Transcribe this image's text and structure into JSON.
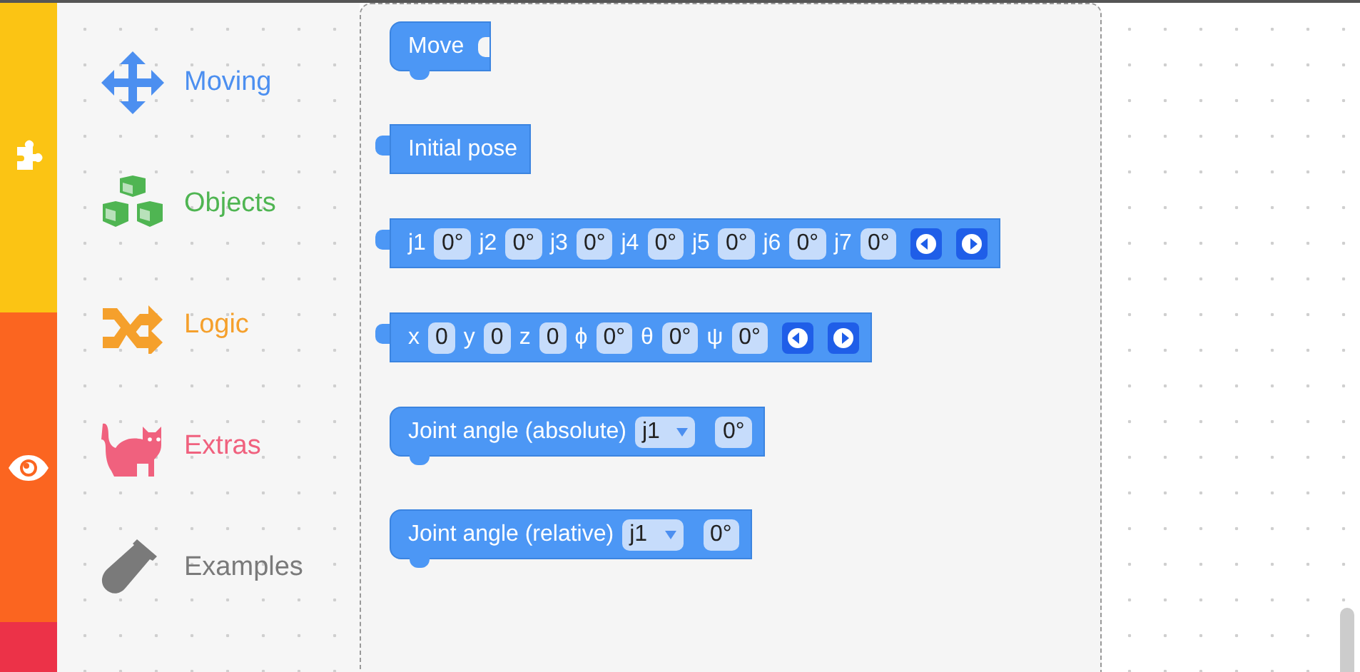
{
  "rail": [
    {
      "kind": "puzzle",
      "color": "#fbc414"
    },
    {
      "kind": "eye",
      "color": "#fb6520"
    },
    {
      "kind": "none",
      "color": "#ec3248"
    }
  ],
  "categories": [
    {
      "label": "Moving",
      "color": "#4c8ff0"
    },
    {
      "label": "Objects",
      "color": "#4fb552"
    },
    {
      "label": "Logic",
      "color": "#f5a02c"
    },
    {
      "label": "Extras",
      "color": "#f0617e"
    },
    {
      "label": "Examples",
      "color": "#7a7a7a"
    }
  ],
  "blocks": [
    {
      "kind": "statement",
      "socket": true,
      "parts": [
        {
          "kind": "label",
          "text": "Move"
        }
      ]
    },
    {
      "kind": "value",
      "parts": [
        {
          "kind": "label",
          "text": "Initial pose"
        }
      ]
    },
    {
      "kind": "value",
      "parts": [
        {
          "kind": "label",
          "text": "j1"
        },
        {
          "kind": "field",
          "text": "0°"
        },
        {
          "kind": "label",
          "text": "j2"
        },
        {
          "kind": "field",
          "text": "0°"
        },
        {
          "kind": "label",
          "text": "j3"
        },
        {
          "kind": "field",
          "text": "0°"
        },
        {
          "kind": "label",
          "text": "j4"
        },
        {
          "kind": "field",
          "text": "0°"
        },
        {
          "kind": "label",
          "text": "j5"
        },
        {
          "kind": "field",
          "text": "0°"
        },
        {
          "kind": "label",
          "text": "j6"
        },
        {
          "kind": "field",
          "text": "0°"
        },
        {
          "kind": "label",
          "text": "j7"
        },
        {
          "kind": "field",
          "text": "0°"
        },
        {
          "kind": "minus"
        },
        {
          "kind": "plus"
        }
      ]
    },
    {
      "kind": "value",
      "parts": [
        {
          "kind": "label",
          "text": "x"
        },
        {
          "kind": "field",
          "text": "0"
        },
        {
          "kind": "label",
          "text": "y"
        },
        {
          "kind": "field",
          "text": "0"
        },
        {
          "kind": "label",
          "text": "z"
        },
        {
          "kind": "field",
          "text": "0"
        },
        {
          "kind": "label",
          "text": "ϕ"
        },
        {
          "kind": "field",
          "text": "0°"
        },
        {
          "kind": "label",
          "text": "θ"
        },
        {
          "kind": "field",
          "text": "0°"
        },
        {
          "kind": "label",
          "text": "ψ"
        },
        {
          "kind": "field",
          "text": "0°"
        },
        {
          "kind": "minus"
        },
        {
          "kind": "plus"
        }
      ]
    },
    {
      "kind": "statement",
      "socket": false,
      "parts": [
        {
          "kind": "label",
          "text": "Joint angle (absolute)"
        },
        {
          "kind": "dropdown",
          "text": "j1"
        },
        {
          "kind": "field",
          "text": "0°"
        }
      ]
    },
    {
      "kind": "statement",
      "socket": false,
      "parts": [
        {
          "kind": "label",
          "text": "Joint angle (relative)"
        },
        {
          "kind": "dropdown",
          "text": "j1"
        },
        {
          "kind": "field",
          "text": "0°"
        }
      ]
    }
  ]
}
